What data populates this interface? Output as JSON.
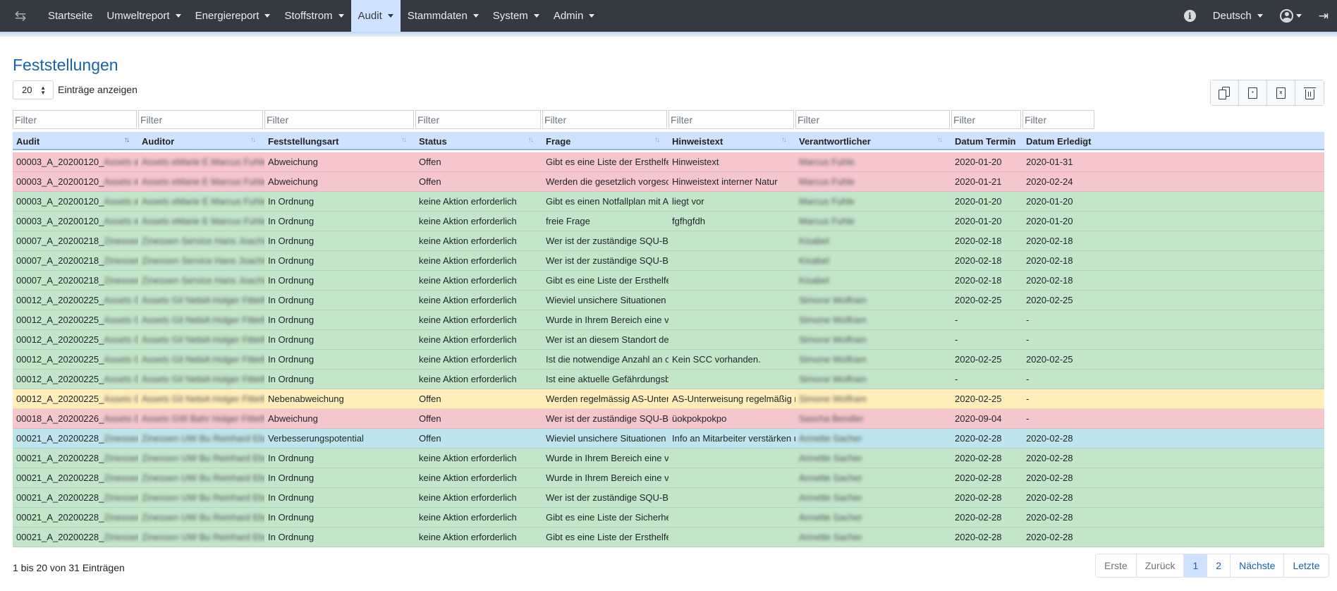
{
  "nav": {
    "items": [
      {
        "label": "Startseite",
        "dropdown": false,
        "active": false
      },
      {
        "label": "Umweltreport",
        "dropdown": true,
        "active": false
      },
      {
        "label": "Energiereport",
        "dropdown": true,
        "active": false
      },
      {
        "label": "Stoffstrom",
        "dropdown": true,
        "active": false
      },
      {
        "label": "Audit",
        "dropdown": true,
        "active": true
      },
      {
        "label": "Stammdaten",
        "dropdown": true,
        "active": false
      },
      {
        "label": "System",
        "dropdown": true,
        "active": false
      },
      {
        "label": "Admin",
        "dropdown": true,
        "active": false
      }
    ],
    "language": "Deutsch",
    "info_icon": "info-circle-icon",
    "user_icon": "user-circle-icon",
    "logout_icon": "sign-out-icon",
    "toggle_icon": "exchange-arrows-icon"
  },
  "page": {
    "title": "Feststellungen",
    "page_length": "20",
    "page_length_label": "Einträge anzeigen"
  },
  "toolbar": {
    "buttons": [
      "copy-icon",
      "pdf-file-icon",
      "excel-file-icon",
      "trash-icon"
    ]
  },
  "table": {
    "filter_placeholder": "Filter",
    "columns": [
      "Audit",
      "Auditor",
      "Feststellungsart",
      "Status",
      "Frage",
      "Hinweistext",
      "Verantwortlicher",
      "Datum Termin",
      "Datum Erledigt"
    ],
    "rows": [
      {
        "status_color": "red",
        "cells": [
          "00003_A_20200120_",
          "Assets eMarie E Marcus Fuhle",
          "Abweichung",
          "Offen",
          "Gibt es eine Liste der Ersthelfer?",
          "Hinweistext",
          "Marcus Fuhle",
          "2020-01-20",
          "2020-01-31"
        ]
      },
      {
        "status_color": "red",
        "cells": [
          "00003_A_20200120_",
          "Assets eMarie E Marcus Fuhle",
          "Abweichung",
          "Offen",
          "Werden die gesetzlich vorgeschriebenen",
          "Hinweistext interner Natur",
          "Marcus Fuhle",
          "2020-01-21",
          "2020-02-24"
        ]
      },
      {
        "status_color": "green",
        "cells": [
          "00003_A_20200120_",
          "Assets eMarie E Marcus Fuhle",
          "In Ordnung",
          "keine Aktion erforderlich",
          "Gibt es einen Notfallplan mit Anweisungen",
          "liegt vor",
          "Marcus Fuhle",
          "2020-01-20",
          "2020-01-20"
        ]
      },
      {
        "status_color": "green",
        "cells": [
          "00003_A_20200120_",
          "Assets eMarie E Marcus Fuhle",
          "In Ordnung",
          "keine Aktion erforderlich",
          "freie Frage",
          "fgfhgfdh",
          "Marcus Fuhle",
          "2020-01-20",
          "2020-01-20"
        ]
      },
      {
        "status_color": "green",
        "cells": [
          "00007_A_20200218_",
          "Zinessen Service Hans Joachim Neugebauer",
          "In Ordnung",
          "keine Aktion erforderlich",
          "Wer ist der zuständige SQU-Beauftragte",
          "",
          "Kisabel",
          "2020-02-18",
          "2020-02-18"
        ]
      },
      {
        "status_color": "green",
        "cells": [
          "00007_A_20200218_",
          "Zinessen Service Hans Joachim Neugebauer",
          "In Ordnung",
          "keine Aktion erforderlich",
          "Wer ist der zuständige SQU-Beauftragte",
          "",
          "Kisabel",
          "2020-02-18",
          "2020-02-18"
        ]
      },
      {
        "status_color": "green",
        "cells": [
          "00007_A_20200218_",
          "Zinessen Service Hans Joachim Neugebauer",
          "In Ordnung",
          "keine Aktion erforderlich",
          "Gibt es eine Liste der Ersthelfer?",
          "",
          "Kisabel",
          "2020-02-18",
          "2020-02-18"
        ]
      },
      {
        "status_color": "green",
        "cells": [
          "00012_A_20200225_",
          "Assets Gil NebiA Holger Fitteth",
          "In Ordnung",
          "keine Aktion erforderlich",
          "Wieviel unsichere Situationen wurden",
          "",
          "Simone Wolfram",
          "2020-02-25",
          "2020-02-25"
        ]
      },
      {
        "status_color": "green",
        "cells": [
          "00012_A_20200225_",
          "Assets Gil NebiA Holger Fitteth",
          "In Ordnung",
          "keine Aktion erforderlich",
          "Wurde in Ihrem Bereich eine vEFK fest",
          "",
          "Simone Wolfram",
          "-",
          "-"
        ]
      },
      {
        "status_color": "green",
        "cells": [
          "00012_A_20200225_",
          "Assets Gil NebiA Holger Fitteth",
          "In Ordnung",
          "keine Aktion erforderlich",
          "Wer ist an diesem Standort der Beauftragte",
          "",
          "Simone Wolfram",
          "-",
          "-"
        ]
      },
      {
        "status_color": "green",
        "cells": [
          "00012_A_20200225_",
          "Assets Gil NebiA Holger Fitteth",
          "In Ordnung",
          "keine Aktion erforderlich",
          "Ist die notwendige Anzahl an operativen",
          "Kein SCC vorhanden.",
          "Simone Wolfram",
          "2020-02-25",
          "2020-02-25"
        ]
      },
      {
        "status_color": "green",
        "cells": [
          "00012_A_20200225_",
          "Assets Gil NebiA Holger Fitteth",
          "In Ordnung",
          "keine Aktion erforderlich",
          "Ist eine aktuelle Gefährdungsbeurteilung",
          "",
          "Simone Wolfram",
          "-",
          "-"
        ]
      },
      {
        "status_color": "yellow",
        "cells": [
          "00012_A_20200225_",
          "Assets Gil NebiA Holger Fitteth",
          "Nebenabweichung",
          "Offen",
          "Werden regelmässig AS-Unterweisungen",
          "AS-Unterweisung regelmäßig mindestens",
          "Simone Wolfram",
          "2020-02-25",
          "-"
        ]
      },
      {
        "status_color": "red",
        "cells": [
          "00018_A_20200226_",
          "Assets GW Bahr Holger Fitteth",
          "Abweichung",
          "Offen",
          "Wer ist der zuständige SQU-Beauftragte",
          "üokpokpokpo",
          "Sascha Bendler",
          "2020-09-04",
          "-"
        ]
      },
      {
        "status_color": "blue",
        "cells": [
          "00021_A_20200228_",
          "Zinessen UW Bu Reinhard Ebeling",
          "Verbesserungspotential",
          "Offen",
          "Wieviel unsichere Situationen wurden",
          "Info an Mitarbeiter verstärken und verbessern",
          "Annette Sacher",
          "2020-02-28",
          "2020-02-28"
        ]
      },
      {
        "status_color": "green",
        "cells": [
          "00021_A_20200228_",
          "Zinessen UW Bu Reinhard Ebeling",
          "In Ordnung",
          "keine Aktion erforderlich",
          "Wurde in Ihrem Bereich eine vEFK fest",
          "",
          "Annette Sacher",
          "2020-02-28",
          "2020-02-28"
        ]
      },
      {
        "status_color": "green",
        "cells": [
          "00021_A_20200228_",
          "Zinessen UW Bu Reinhard Ebeling",
          "In Ordnung",
          "keine Aktion erforderlich",
          "Wurde in Ihrem Bereich eine vEFK fest",
          "",
          "Annette Sacher",
          "2020-02-28",
          "2020-02-28"
        ]
      },
      {
        "status_color": "green",
        "cells": [
          "00021_A_20200228_",
          "Zinessen UW Bu Reinhard Ebeling",
          "In Ordnung",
          "keine Aktion erforderlich",
          "Wer ist der zuständige SQU-Beauftragte",
          "",
          "Annette Sacher",
          "2020-02-28",
          "2020-02-28"
        ]
      },
      {
        "status_color": "green",
        "cells": [
          "00021_A_20200228_",
          "Zinessen UW Bu Reinhard Ebeling",
          "In Ordnung",
          "keine Aktion erforderlich",
          "Gibt es eine Liste der Sicherheitsbeauftragten",
          "",
          "Annette Sacher",
          "2020-02-28",
          "2020-02-28"
        ]
      },
      {
        "status_color": "green",
        "cells": [
          "00021_A_20200228_",
          "Zinessen UW Bu Reinhard Ebeling",
          "In Ordnung",
          "keine Aktion erforderlich",
          "Gibt es eine Liste der Ersthelfer?",
          "",
          "Annette Sacher",
          "2020-02-28",
          "2020-02-28"
        ]
      }
    ]
  },
  "footer": {
    "info": "1 bis 20 von 31 Einträgen",
    "pagination": [
      {
        "label": "Erste",
        "state": "disabled"
      },
      {
        "label": "Zurück",
        "state": "disabled"
      },
      {
        "label": "1",
        "state": "current"
      },
      {
        "label": "2",
        "state": "normal"
      },
      {
        "label": "Nächste",
        "state": "normal"
      },
      {
        "label": "Letzte",
        "state": "normal"
      }
    ]
  }
}
